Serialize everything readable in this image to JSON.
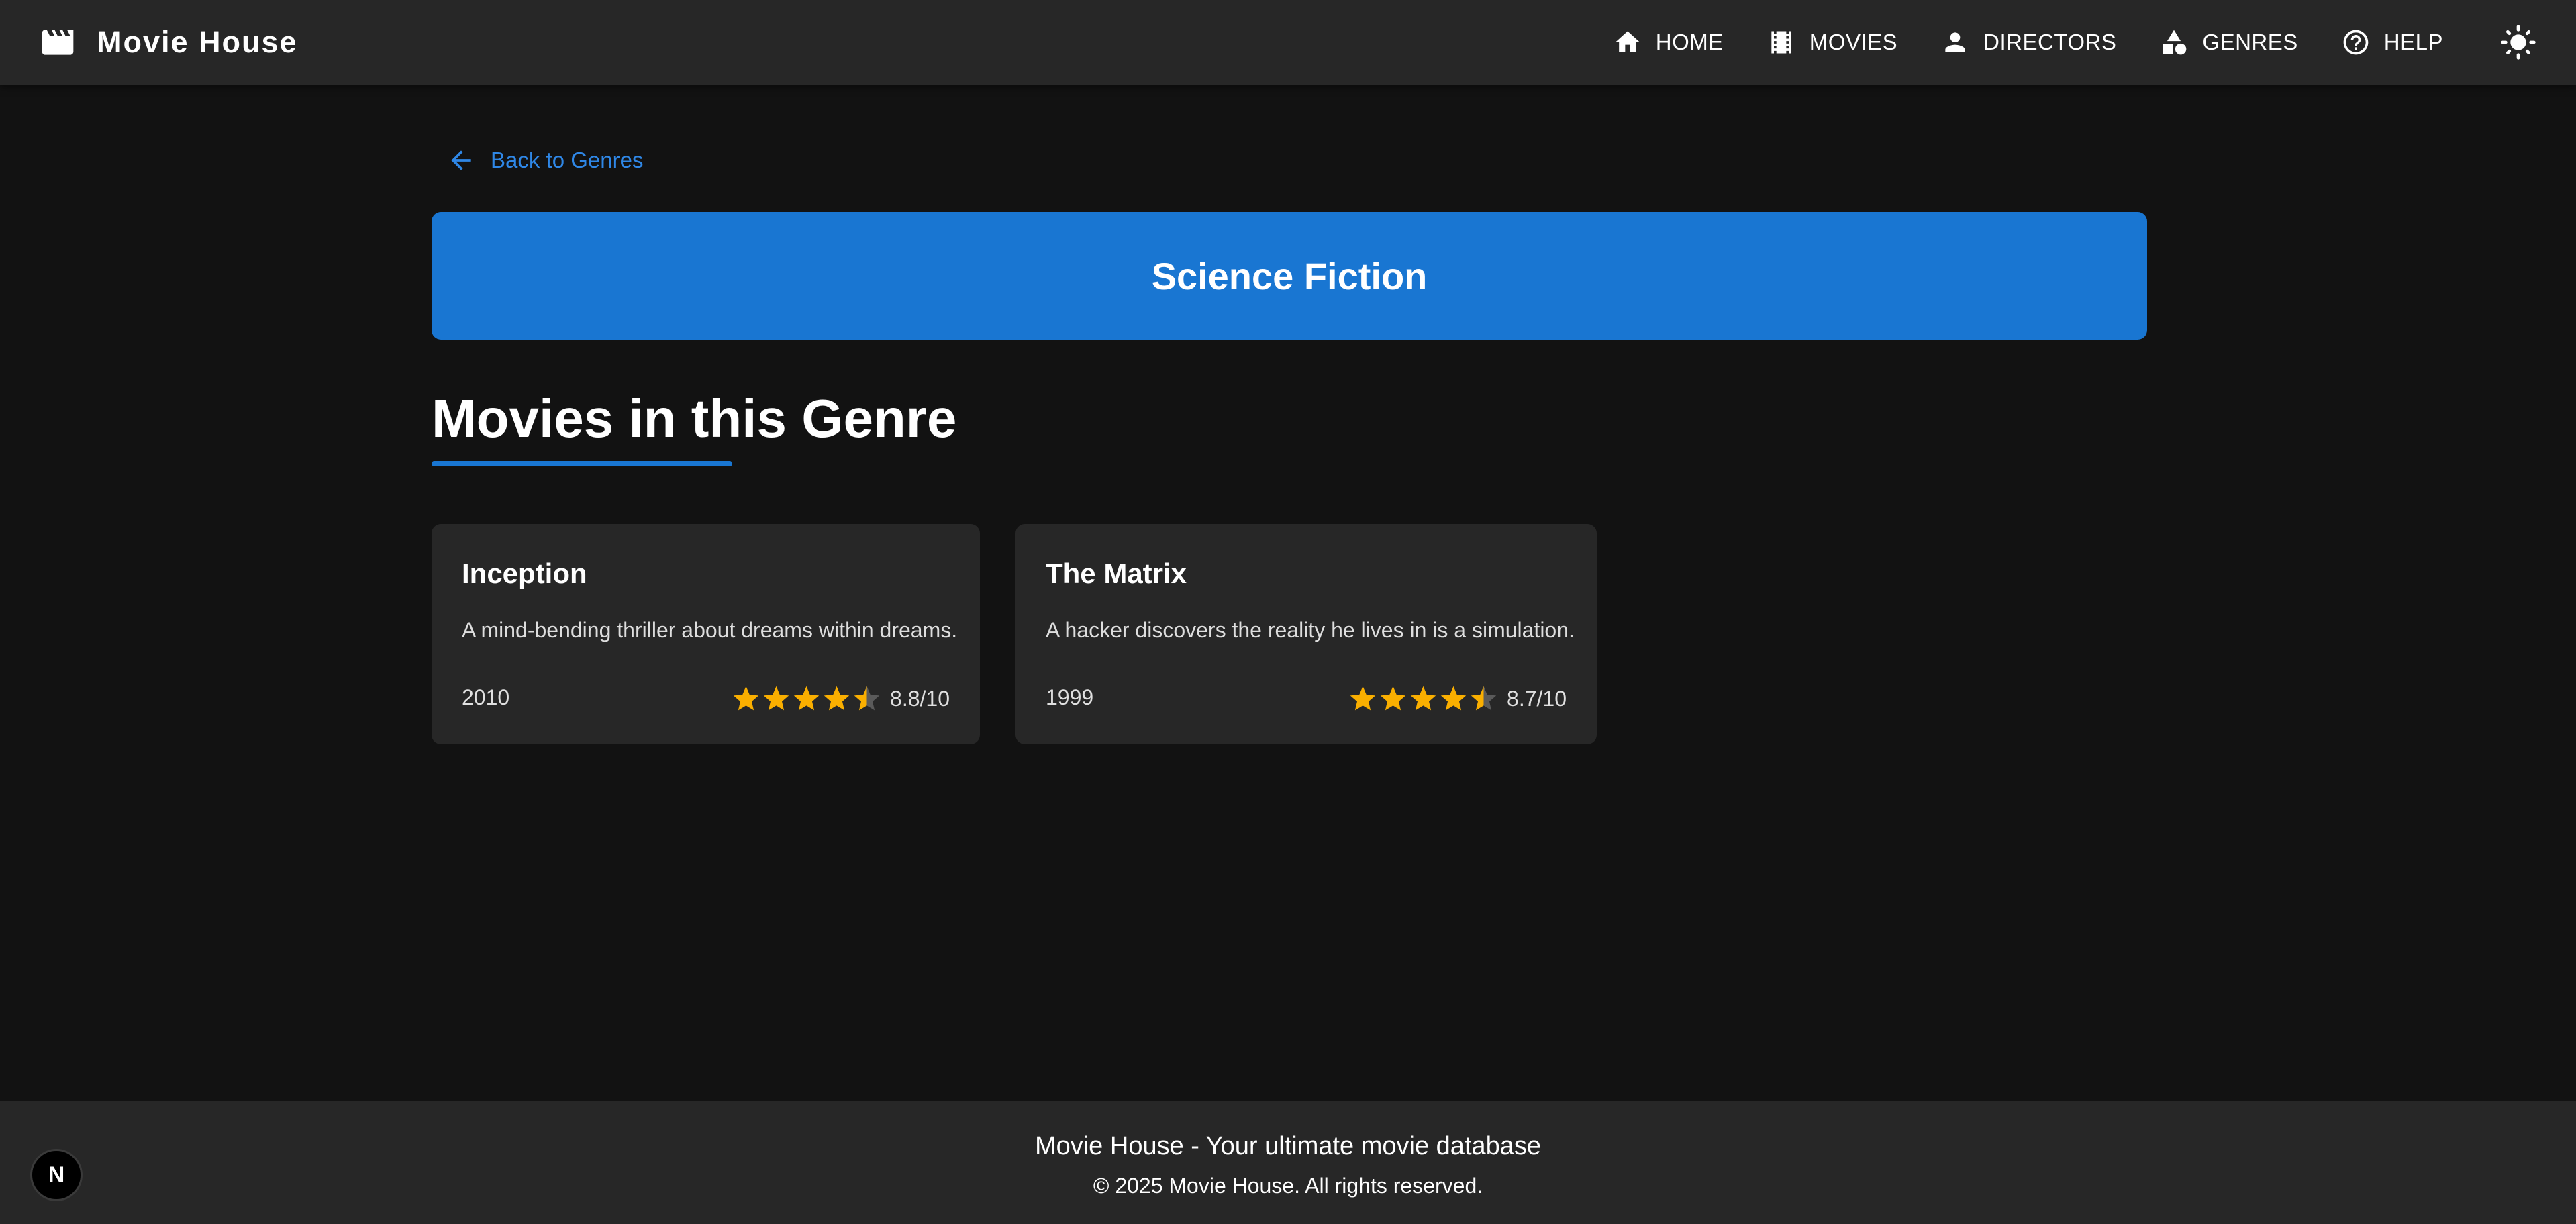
{
  "header": {
    "brand": {
      "title": "Movie House",
      "icon": "movie-clapperboard-icon"
    },
    "nav": [
      {
        "label": "HOME",
        "icon": "home-icon"
      },
      {
        "label": "MOVIES",
        "icon": "film-icon"
      },
      {
        "label": "DIRECTORS",
        "icon": "person-icon"
      },
      {
        "label": "GENRES",
        "icon": "category-shapes-icon"
      },
      {
        "label": "HELP",
        "icon": "help-circle-icon"
      }
    ],
    "theme_toggle": {
      "icon": "sun-icon"
    }
  },
  "main": {
    "back_link": {
      "label": "Back to Genres",
      "icon": "arrow-left-icon"
    },
    "genre": {
      "name": "Science Fiction"
    },
    "section_title": "Movies in this Genre",
    "movies": [
      {
        "title": "Inception",
        "description": "A mind-bending thriller about dreams within dreams.",
        "year": "2010",
        "rating": 8.8,
        "rating_text": "8.8/10",
        "stars_filled": 4.5,
        "stars_total": 5
      },
      {
        "title": "The Matrix",
        "description": "A hacker discovers the reality he lives in is a simulation.",
        "year": "1999",
        "rating": 8.7,
        "rating_text": "8.7/10",
        "stars_filled": 4.5,
        "stars_total": 5
      }
    ]
  },
  "footer": {
    "tagline": "Movie House - Your ultimate movie database",
    "copyright": "© 2025 Movie House. All rights reserved.",
    "dev_badge": "N"
  },
  "colors": {
    "background": "#121212",
    "surface": "#272727",
    "primary": "#1976d2",
    "link": "#2f87e6",
    "star": "#faaf00",
    "star_empty": "#5a5a5a"
  }
}
